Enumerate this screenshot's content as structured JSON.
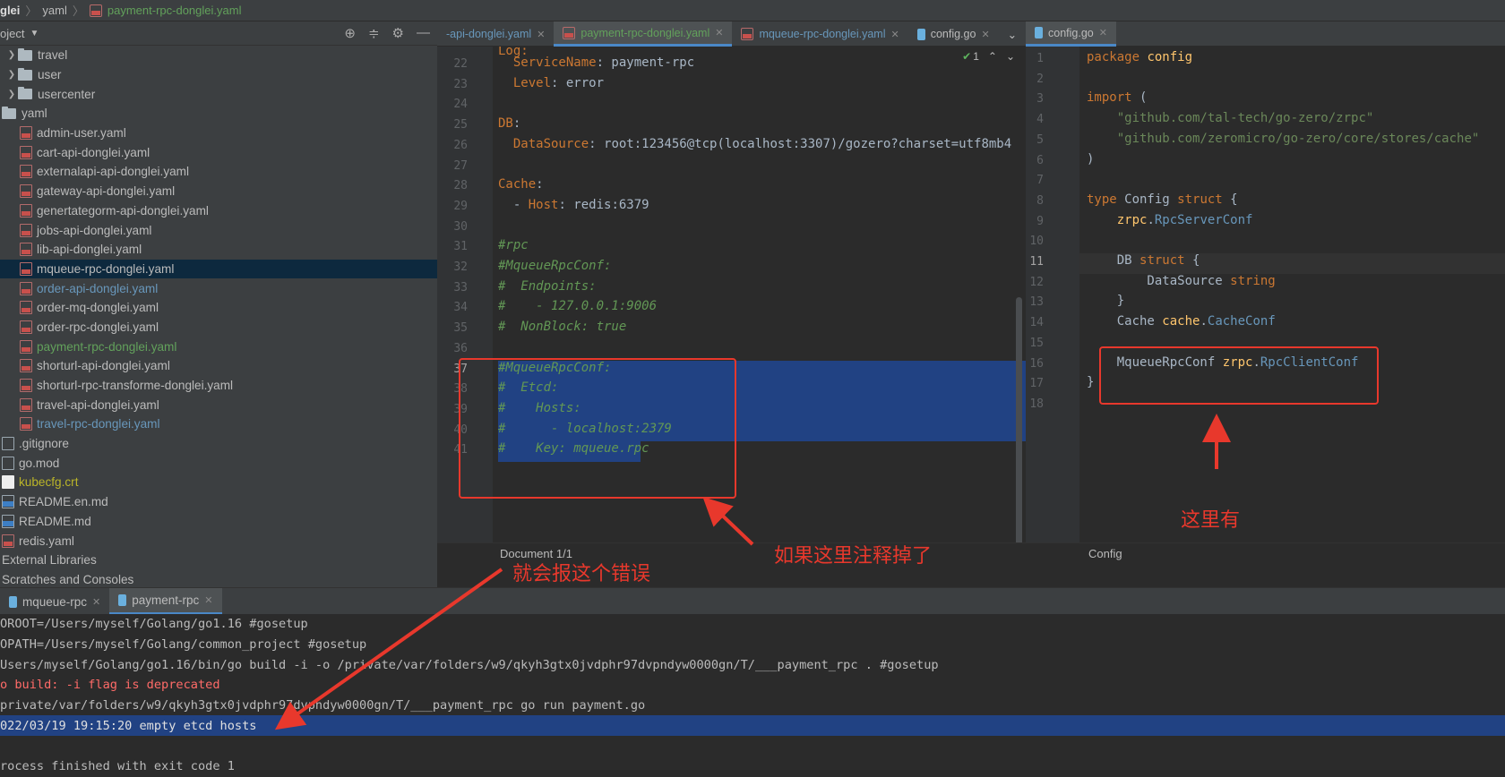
{
  "breadcrumb": [
    "glei",
    "yaml",
    "payment-rpc-donglei.yaml"
  ],
  "project_panel": {
    "title": "oject",
    "tree": [
      {
        "label": "travel",
        "type": "folder",
        "depth": 1,
        "expand": true,
        "color": "#bbbbbb"
      },
      {
        "label": "user",
        "type": "folder",
        "depth": 1,
        "expand": true,
        "color": "#bbbbbb"
      },
      {
        "label": "usercenter",
        "type": "folder",
        "depth": 1,
        "expand": true,
        "color": "#bbbbbb"
      },
      {
        "label": "yaml",
        "type": "folder",
        "depth": 0,
        "expand": false,
        "color": "#bbbbbb"
      },
      {
        "label": "admin-user.yaml",
        "type": "yml",
        "depth": 2,
        "color": "#bbbbbb"
      },
      {
        "label": "cart-api-donglei.yaml",
        "type": "yml",
        "depth": 2,
        "color": "#bbbbbb"
      },
      {
        "label": "externalapi-api-donglei.yaml",
        "type": "yml",
        "depth": 2,
        "color": "#bbbbbb"
      },
      {
        "label": "gateway-api-donglei.yaml",
        "type": "yml",
        "depth": 2,
        "color": "#bbbbbb"
      },
      {
        "label": "genertategorm-api-donglei.yaml",
        "type": "yml",
        "depth": 2,
        "color": "#bbbbbb"
      },
      {
        "label": "jobs-api-donglei.yaml",
        "type": "yml",
        "depth": 2,
        "color": "#bbbbbb"
      },
      {
        "label": "lib-api-donglei.yaml",
        "type": "yml",
        "depth": 2,
        "color": "#bbbbbb"
      },
      {
        "label": "mqueue-rpc-donglei.yaml",
        "type": "yml",
        "depth": 2,
        "color": "#bbbbbb",
        "selected": true
      },
      {
        "label": "order-api-donglei.yaml",
        "type": "yml",
        "depth": 2,
        "color": "#6897bb"
      },
      {
        "label": "order-mq-donglei.yaml",
        "type": "yml",
        "depth": 2,
        "color": "#bbbbbb"
      },
      {
        "label": "order-rpc-donglei.yaml",
        "type": "yml",
        "depth": 2,
        "color": "#bbbbbb"
      },
      {
        "label": "payment-rpc-donglei.yaml",
        "type": "yml",
        "depth": 2,
        "color": "#62a15b"
      },
      {
        "label": "shorturl-api-donglei.yaml",
        "type": "yml",
        "depth": 2,
        "color": "#bbbbbb"
      },
      {
        "label": "shorturl-rpc-transforme-donglei.yaml",
        "type": "yml",
        "depth": 2,
        "color": "#bbbbbb"
      },
      {
        "label": "travel-api-donglei.yaml",
        "type": "yml",
        "depth": 2,
        "color": "#bbbbbb"
      },
      {
        "label": "travel-rpc-donglei.yaml",
        "type": "yml",
        "depth": 2,
        "color": "#6897bb"
      },
      {
        "label": ".gitignore",
        "type": "file",
        "depth": 0,
        "color": "#bbbbbb"
      },
      {
        "label": "go.mod",
        "type": "file",
        "depth": 0,
        "color": "#bbbbbb"
      },
      {
        "label": "kubecfg.crt",
        "type": "crt",
        "depth": 0,
        "color": "#bbb529"
      },
      {
        "label": "README.en.md",
        "type": "md",
        "depth": 0,
        "color": "#bbbbbb"
      },
      {
        "label": "README.md",
        "type": "md",
        "depth": 0,
        "color": "#bbbbbb"
      },
      {
        "label": "redis.yaml",
        "type": "yml",
        "depth": 0,
        "color": "#bbbbbb"
      },
      {
        "label": "External Libraries",
        "type": "none",
        "depth": 0,
        "color": "#bbbbbb"
      },
      {
        "label": "Scratches and Consoles",
        "type": "none",
        "depth": 0,
        "color": "#bbbbbb"
      }
    ]
  },
  "left_tabs": [
    {
      "label": "-api-donglei.yaml",
      "icon": "none",
      "active": false,
      "color": "#6897bb"
    },
    {
      "label": "payment-rpc-donglei.yaml",
      "icon": "yml",
      "active": true,
      "color": "#62a15b"
    },
    {
      "label": "mqueue-rpc-donglei.yaml",
      "icon": "yml",
      "active": false,
      "color": "#6897bb"
    },
    {
      "label": "config.go",
      "icon": "go",
      "active": false,
      "color": "#bbbbbb"
    }
  ],
  "right_tabs": [
    {
      "label": "config.go",
      "icon": "go",
      "active": true,
      "color": "#bbbbbb"
    }
  ],
  "left_editor": {
    "top_partial": "Log:",
    "lines": [
      {
        "n": "22",
        "html": "  <span class='k-key'>ServiceName</span>: payment-rpc"
      },
      {
        "n": "23",
        "html": "  <span class='k-key'>Level</span>: error"
      },
      {
        "n": "24",
        "html": ""
      },
      {
        "n": "25",
        "html": "<span class='k-key'>DB</span>:"
      },
      {
        "n": "26",
        "html": "  <span class='k-key'>DataSource</span>: root:123456@tcp(localhost:3307)/gozero?charset=utf8mb4"
      },
      {
        "n": "27",
        "html": ""
      },
      {
        "n": "28",
        "html": "<span class='k-key'>Cache</span>:"
      },
      {
        "n": "29",
        "html": "  - <span class='k-key'>Host</span>: redis:6379"
      },
      {
        "n": "30",
        "html": ""
      },
      {
        "n": "31",
        "html": "<span class='k-com'>#rpc</span>"
      },
      {
        "n": "32",
        "html": "<span class='k-com'>#MqueueRpcConf:</span>"
      },
      {
        "n": "33",
        "html": "<span class='k-com'>#  Endpoints:</span>"
      },
      {
        "n": "34",
        "html": "<span class='k-com'>#    - 127.0.0.1:9006</span>"
      },
      {
        "n": "35",
        "html": "<span class='k-com'>#  NonBlock: true</span>"
      },
      {
        "n": "36",
        "html": ""
      },
      {
        "n": "37",
        "html": "<span class='k-com'>#MqueueRpcConf:</span>"
      },
      {
        "n": "38",
        "html": "<span class='k-com'>#  Etcd:</span>"
      },
      {
        "n": "39",
        "html": "<span class='k-com'>#    Hosts:</span>"
      },
      {
        "n": "40",
        "html": "<span class='k-com'>#      - localhost:2379</span>"
      },
      {
        "n": "41",
        "html": "<span class='k-com'>#    Key: mqueue.rpc</span>"
      }
    ],
    "inspection_count": "1",
    "status": "Document 1/1"
  },
  "right_editor": {
    "lines": [
      {
        "n": "1",
        "html": "<span class='k-kw'>package</span> <span class='k-pkg'>config</span>"
      },
      {
        "n": "2",
        "html": ""
      },
      {
        "n": "3",
        "html": "<span class='k-kw'>import</span> ("
      },
      {
        "n": "4",
        "html": "    <span class='k-str'>\"github.com/tal-tech/go-zero/zrpc\"</span>"
      },
      {
        "n": "5",
        "html": "    <span class='k-str'>\"github.com/zeromicro/go-zero/core/stores/cache\"</span>"
      },
      {
        "n": "6",
        "html": ")"
      },
      {
        "n": "7",
        "html": ""
      },
      {
        "n": "8",
        "html": "<span class='k-kw'>type</span> Config <span class='k-kw'>struct</span> {"
      },
      {
        "n": "9",
        "html": "    <span class='k-pkg'>zrpc</span>.<span class='k-type'>RpcServerConf</span>"
      },
      {
        "n": "10",
        "html": ""
      },
      {
        "n": "11",
        "html": "    DB <span class='k-kw'>struct</span> {"
      },
      {
        "n": "12",
        "html": "        DataSource <span class='k-kw'>string</span>"
      },
      {
        "n": "13",
        "html": "    }"
      },
      {
        "n": "14",
        "html": "    Cache <span class='k-pkg'>cache</span>.<span class='k-type'>CacheConf</span>"
      },
      {
        "n": "15",
        "html": ""
      },
      {
        "n": "16",
        "html": "    MqueueRpcConf <span class='k-pkg'>zrpc</span>.<span class='k-type'>RpcClientConf</span>"
      },
      {
        "n": "17",
        "html": "}"
      },
      {
        "n": "18",
        "html": ""
      }
    ],
    "status": "Config"
  },
  "run_tabs": [
    {
      "label": "mqueue-rpc",
      "active": false
    },
    {
      "label": "payment-rpc",
      "active": true
    }
  ],
  "console": [
    {
      "text": "OROOT=/Users/myself/Golang/go1.16 #gosetup",
      "kind": "normal"
    },
    {
      "text": "OPATH=/Users/myself/Golang/common_project #gosetup",
      "kind": "normal"
    },
    {
      "text": "Users/myself/Golang/go1.16/bin/go build -i -o /private/var/folders/w9/qkyh3gtx0jvdphr97dvpndyw0000gn/T/___payment_rpc . #gosetup",
      "kind": "normal"
    },
    {
      "text": "o build: -i flag is deprecated",
      "kind": "err"
    },
    {
      "text": "private/var/folders/w9/qkyh3gtx0jvdphr97dvpndyw0000gn/T/___payment_rpc go run payment.go",
      "kind": "normal"
    },
    {
      "text": "022/03/19 19:15:20 empty etcd hosts",
      "kind": "hl"
    },
    {
      "text": "",
      "kind": "normal"
    },
    {
      "text": "rocess finished with exit code 1",
      "kind": "normal"
    }
  ],
  "annotations": {
    "note_comment": "如果这里注释掉了",
    "note_error": "就会报这个错误",
    "note_here": "这里有",
    "color": "#e8382c"
  }
}
